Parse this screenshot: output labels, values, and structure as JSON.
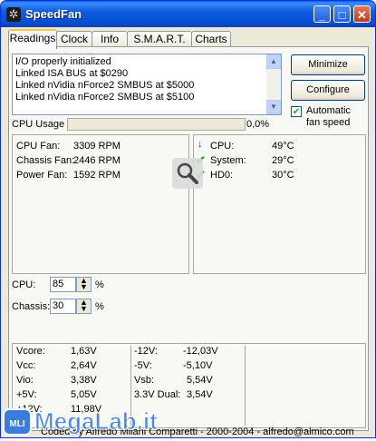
{
  "window": {
    "title": "SpeedFan",
    "minimize_symbol": "_",
    "maximize_symbol": "□",
    "close_symbol": "✕"
  },
  "tabs": [
    {
      "label": "Readings",
      "active": true
    },
    {
      "label": "Clock"
    },
    {
      "label": "Info"
    },
    {
      "label": "S.M.A.R.T."
    },
    {
      "label": "Charts"
    }
  ],
  "log_lines": [
    "I/O properly initialized",
    "Linked ISA BUS at $0290",
    "Linked nVidia nForce2 SMBUS at $5000",
    "Linked nVidia nForce2 SMBUS at $5100"
  ],
  "buttons": {
    "minimize": "Minimize",
    "configure": "Configure"
  },
  "auto_fan": {
    "label_line1": "Automatic",
    "label_line2": "fan speed",
    "checked": true
  },
  "cpu_usage": {
    "label": "CPU Usage",
    "value": "0,0%",
    "fraction": 0.0
  },
  "fans": [
    {
      "name": "CPU Fan:",
      "value": "3309 RPM"
    },
    {
      "name": "Chassis Fan:",
      "value": "2446 RPM"
    },
    {
      "name": "Power Fan:",
      "value": "1592 RPM"
    }
  ],
  "temps": [
    {
      "name": "CPU:",
      "value": "49°C",
      "status_icon": "arrow-down-icon",
      "color": "#1a2fd6"
    },
    {
      "name": "System:",
      "value": "29°C",
      "status_icon": "check-icon",
      "color": "#1f9a1f"
    },
    {
      "name": "HD0:",
      "value": "30°C",
      "status_icon": "check-icon",
      "color": "#1f9a1f"
    }
  ],
  "speeds": [
    {
      "label": "CPU:",
      "value": "85",
      "unit": "%"
    },
    {
      "label": "Chassis:",
      "value": "30",
      "unit": "%"
    }
  ],
  "voltages_col1": [
    {
      "name": "Vcore:",
      "value": "1,63V"
    },
    {
      "name": "Vcc:",
      "value": "2,64V"
    },
    {
      "name": "Vio:",
      "value": "3,38V"
    },
    {
      "name": "+5V:",
      "value": "5,05V"
    },
    {
      "name": "+12V:",
      "value": "11,98V"
    }
  ],
  "voltages_col2": [
    {
      "name": "-12V:",
      "value": "-12,03V"
    },
    {
      "name": "-5V:",
      "value": "-5,10V"
    },
    {
      "name": "Vsb:",
      "value": "5,54V"
    },
    {
      "name": "3.3V Dual:",
      "value": "3,54V"
    }
  ],
  "footer": "Coded by Alfredo Milani Comparetti - 2000-2004 - alfredo@almico.com",
  "watermark": {
    "text": "MegaLab.it",
    "badge": "MLI"
  }
}
